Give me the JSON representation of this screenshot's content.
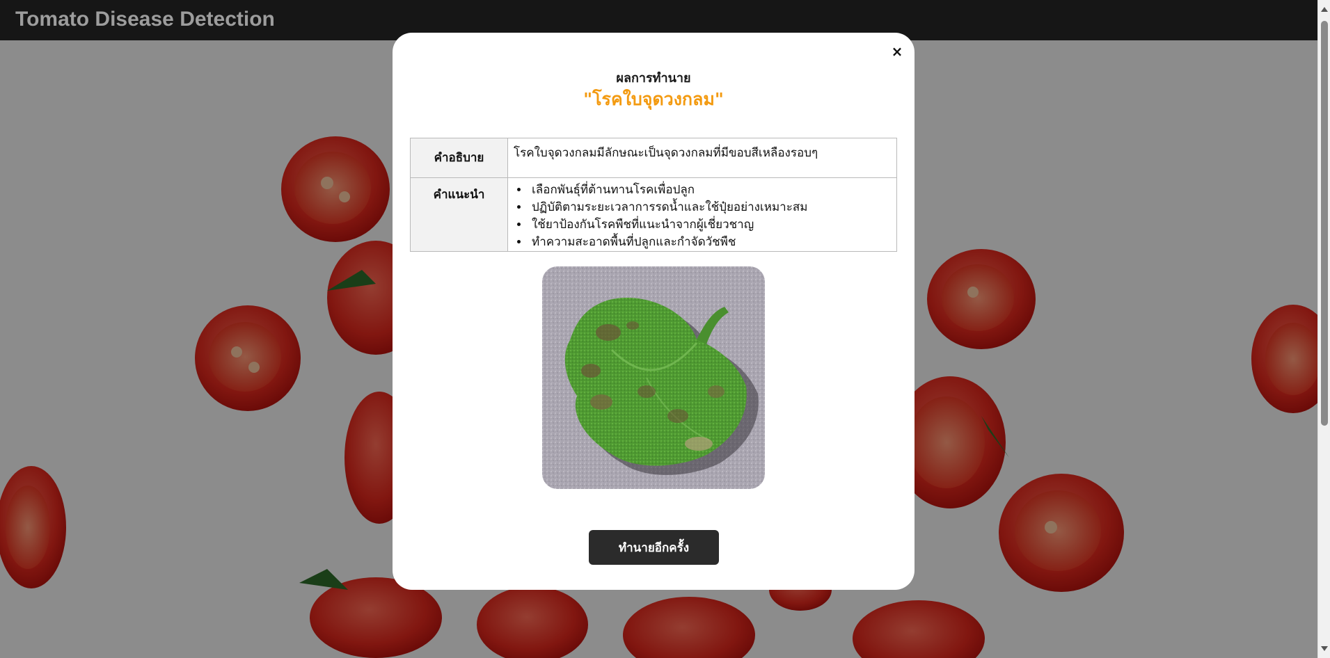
{
  "app": {
    "title": "Tomato Disease Detection"
  },
  "modal": {
    "close_label": "×",
    "heading": "ผลการทำนาย",
    "result": "\"โรคใบจุดวงกลม\"",
    "description_header": "คำอธิบาย",
    "description": "โรคใบจุดวงกลมมีลักษณะเป็นจุดวงกลมที่มีขอบสีเหลืองรอบๆ",
    "recommendation_header": "คำแนะนำ",
    "recommendations": [
      "เลือกพันธุ์ที่ต้านทานโรคเพื่อปลูก",
      "ปฏิบัติตามระยะเวลาการรดน้ำและใช้ปุ๋ยอย่างเหมาะสม",
      "ใช้ยาป้องกันโรคพืชที่แนะนำจากผู้เชี่ยวชาญ",
      "ทำความสะอาดพื้นที่ปลูกและกำจัดวัชพืช"
    ],
    "predict_again_label": "ทำนายอีกครั้ง"
  },
  "colors": {
    "accent": "#f39a10",
    "button_bg": "#2b2b2b",
    "topbar_bg": "#161616"
  }
}
